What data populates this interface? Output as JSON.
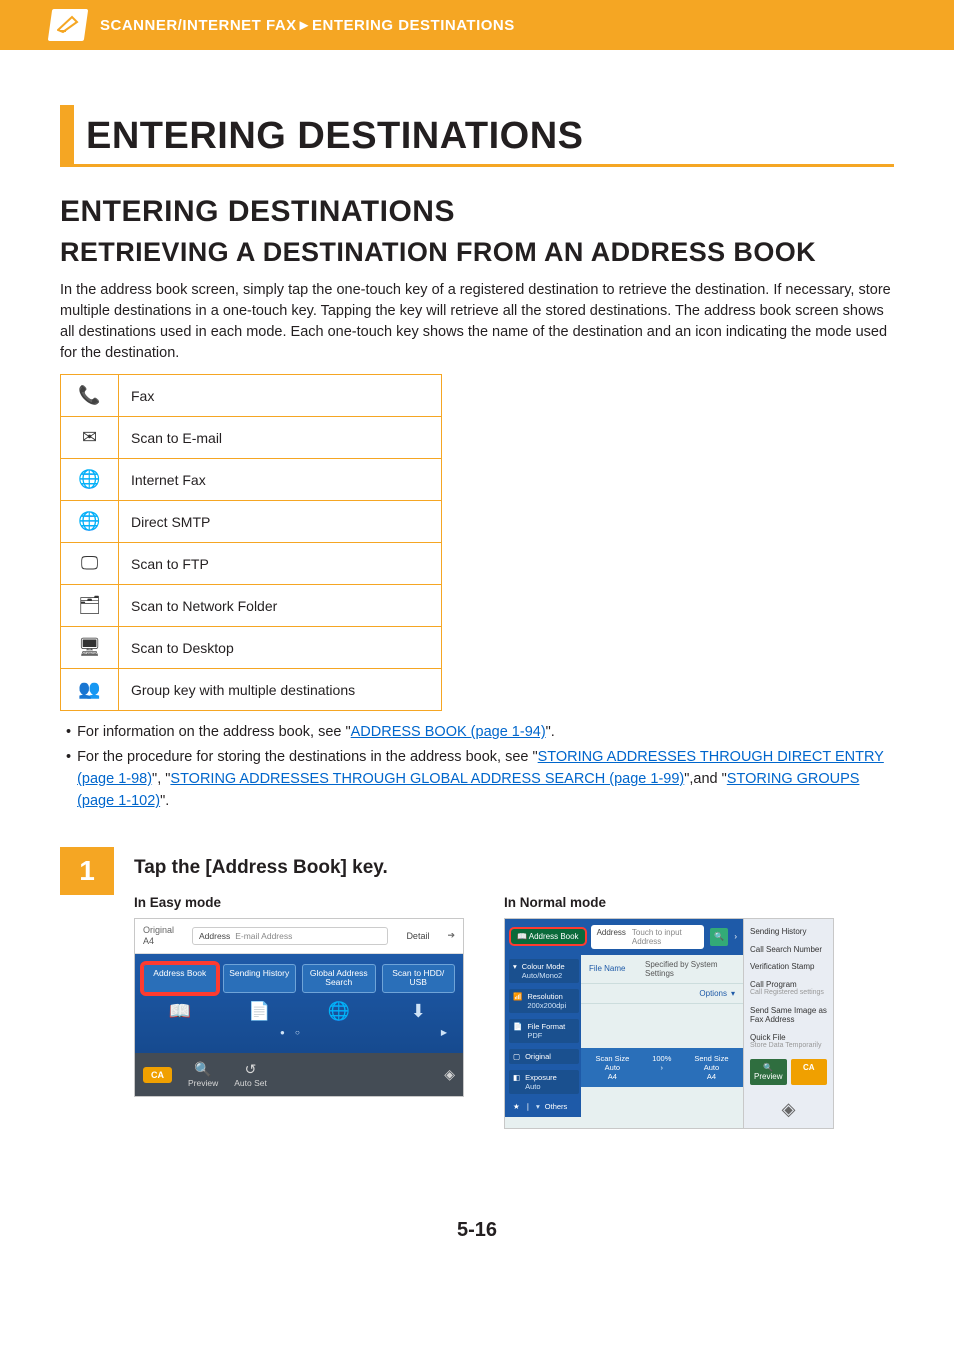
{
  "banner": {
    "breadcrumb": "SCANNER/INTERNET FAX►ENTERING DESTINATIONS"
  },
  "title": "ENTERING DESTINATIONS",
  "h2": "ENTERING DESTINATIONS",
  "h3": "RETRIEVING A DESTINATION FROM AN ADDRESS BOOK",
  "intro": "In the address book screen, simply tap the one-touch key of a registered destination to retrieve the destination. If necessary, store multiple destinations in a one-touch key. Tapping the key will retrieve all the stored destinations. The address book screen shows all destinations used in each mode. Each one-touch key shows the name of the destination and an icon indicating the mode used for the destination.",
  "modes": [
    {
      "icon": "📞",
      "label": "Fax"
    },
    {
      "icon": "✉",
      "label": "Scan to E-mail"
    },
    {
      "icon": "🌐",
      "label": "Internet Fax"
    },
    {
      "icon": "🌐",
      "label": "Direct SMTP"
    },
    {
      "icon": "🖵",
      "label": "Scan to FTP"
    },
    {
      "icon": "🗂",
      "label": "Scan to Network Folder"
    },
    {
      "icon": "🖥",
      "label": "Scan to Desktop"
    },
    {
      "icon": "👥",
      "label": "Group key with multiple destinations"
    }
  ],
  "bullets": {
    "b1_pre": "For information on the address book, see \"",
    "b1_link": "ADDRESS BOOK (page 1-94)",
    "b1_post": "\".",
    "b2_pre": "For the procedure for storing the destinations in the address book, see \"",
    "b2_link1": "STORING ADDRESSES THROUGH DIRECT ENTRY (page 1-98)",
    "b2_mid1": "\", \"",
    "b2_link2": "STORING ADDRESSES THROUGH GLOBAL ADDRESS SEARCH (page 1-99)",
    "b2_mid2": "\",and \"",
    "b2_link3": "STORING GROUPS (page 1-102)",
    "b2_post": "\"."
  },
  "step": {
    "num": "1",
    "title": "Tap the [Address Book] key.",
    "easy_label": "In Easy mode",
    "normal_label": "In Normal mode"
  },
  "easy": {
    "original": "Original",
    "a4": "A4",
    "address_lbl": "Address",
    "address_ph": "E-mail Address",
    "detail": "Detail",
    "buttons": [
      "Address Book",
      "Sending History",
      "Global Address Search",
      "Scan to HDD/ USB"
    ],
    "ca": "CA",
    "preview": "Preview",
    "autoset": "Auto Set"
  },
  "normal": {
    "address_book": "Address Book",
    "addr_label": "Address",
    "addr_ph": "Touch to input Address",
    "file_name": "File Name",
    "file_name_val": "Specified by System Settings",
    "options": "Options",
    "side_rows": [
      {
        "label": "Colour Mode",
        "value": "Auto/Mono2"
      },
      {
        "label": "Resolution",
        "value": "200x200dpi"
      },
      {
        "label": "File Format",
        "value": "PDF"
      },
      {
        "label": "Original",
        "value": ""
      },
      {
        "label": "Exposure",
        "value": "Auto"
      }
    ],
    "others": "Others",
    "scan_size": "Scan Size",
    "send_size": "Send Size",
    "auto": "Auto",
    "a4": "A4",
    "pct": "100%",
    "right": [
      "Sending History",
      "Call Search Number",
      "Verification Stamp",
      "Call Program",
      "Send Same Image as Fax Address",
      "Quick File"
    ],
    "right_sub1": "Call Registered settings",
    "right_sub2": "Store Data Temporarily",
    "preview": "Preview",
    "ca": "CA"
  },
  "page_number": "5-16"
}
